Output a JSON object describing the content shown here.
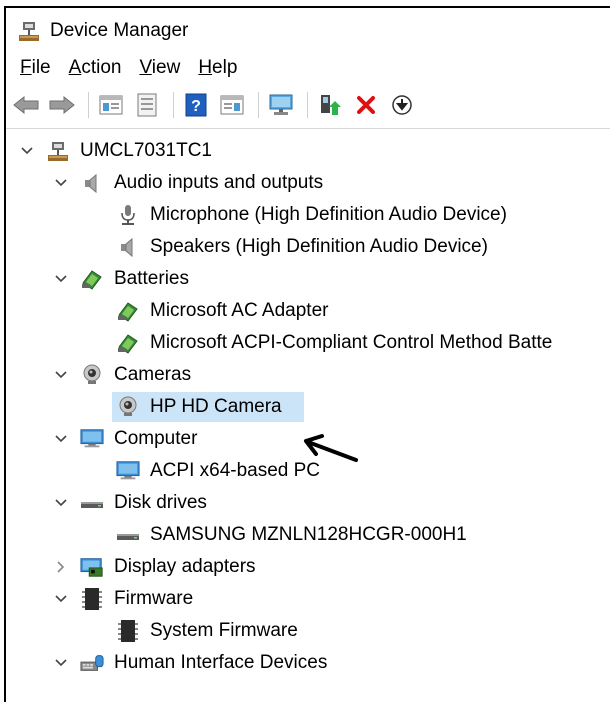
{
  "window": {
    "title": "Device Manager"
  },
  "menu": [
    {
      "key": "F",
      "rest": "ile"
    },
    {
      "key": "A",
      "rest": "ction"
    },
    {
      "key": "V",
      "rest": "iew"
    },
    {
      "key": "H",
      "rest": "elp"
    }
  ],
  "toolbar": [
    "back-icon",
    "forward-icon",
    "show-hide-tree-icon",
    "properties-icon",
    "help-icon",
    "action-pane-icon",
    "monitor-icon",
    "update-driver-icon",
    "uninstall-icon",
    "download-icon"
  ],
  "tree": {
    "root": "UMCL7031TC1",
    "audio": {
      "label": "Audio inputs and outputs",
      "children": [
        "Microphone (High Definition Audio Device)",
        "Speakers (High Definition Audio Device)"
      ]
    },
    "batteries": {
      "label": "Batteries",
      "children": [
        "Microsoft AC Adapter",
        "Microsoft ACPI-Compliant Control Method Batte"
      ]
    },
    "cameras": {
      "label": "Cameras",
      "children": [
        "HP HD Camera"
      ]
    },
    "computer": {
      "label": "Computer",
      "children": [
        "ACPI x64-based PC"
      ]
    },
    "disks": {
      "label": "Disk drives",
      "children": [
        "SAMSUNG MZNLN128HCGR-000H1"
      ]
    },
    "display": {
      "label": "Display adapters"
    },
    "firmware": {
      "label": "Firmware",
      "children": [
        "System Firmware"
      ]
    },
    "hid": {
      "label": "Human Interface Devices"
    }
  },
  "colors": {
    "selection": "#cce4f7",
    "uninstall": "#e01010",
    "help": "#1f5fbf"
  }
}
